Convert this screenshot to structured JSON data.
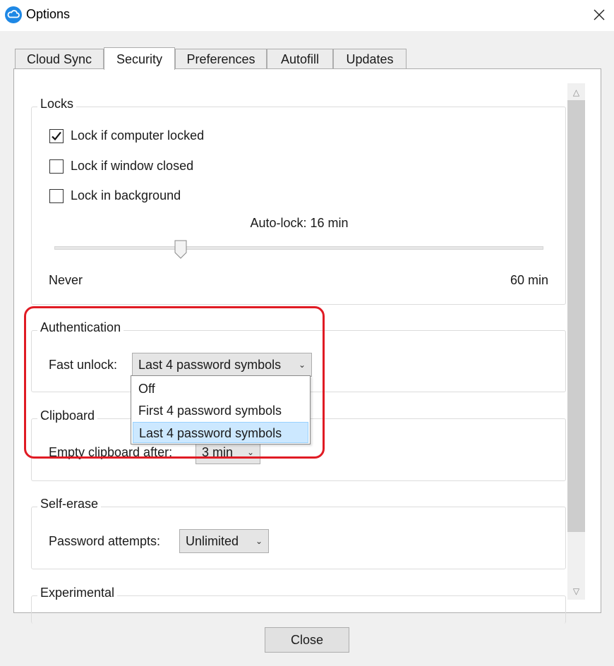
{
  "window": {
    "title": "Options",
    "accent": "#1e88e5"
  },
  "tabs": [
    {
      "label": "Cloud Sync",
      "active": false
    },
    {
      "label": "Security",
      "active": true
    },
    {
      "label": "Preferences",
      "active": false
    },
    {
      "label": "Autofill",
      "active": false
    },
    {
      "label": "Updates",
      "active": false
    }
  ],
  "locks": {
    "legend": "Locks",
    "options": [
      {
        "label": "Lock if computer locked",
        "checked": true
      },
      {
        "label": "Lock if window closed",
        "checked": false
      },
      {
        "label": "Lock in background",
        "checked": false
      }
    ],
    "auto_lock_label": "Auto-lock: 16 min",
    "slider_value_min": 16,
    "slider_min_label": "Never",
    "slider_max_label": "60 min"
  },
  "authentication": {
    "legend": "Authentication",
    "fast_unlock_label": "Fast unlock:",
    "fast_unlock_value": "Last 4 password symbols",
    "dropdown_options": [
      "Off",
      "First 4 password symbols",
      "Last 4 password symbols"
    ],
    "selected_option": "Last 4 password symbols"
  },
  "clipboard": {
    "legend": "Clipboard",
    "label": "Empty clipboard after:",
    "value": "3 min"
  },
  "self_erase": {
    "legend": "Self-erase",
    "label": "Password attempts:",
    "value": "Unlimited"
  },
  "experimental": {
    "legend": "Experimental"
  },
  "footer": {
    "close_label": "Close"
  },
  "highlight_color": "#e01b24"
}
